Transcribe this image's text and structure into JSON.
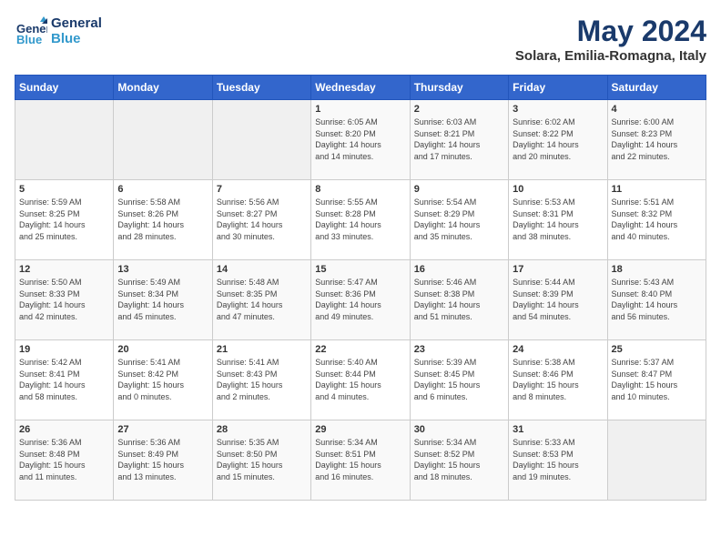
{
  "header": {
    "logo_line1": "General",
    "logo_line2": "Blue",
    "month_year": "May 2024",
    "location": "Solara, Emilia-Romagna, Italy"
  },
  "days_of_week": [
    "Sunday",
    "Monday",
    "Tuesday",
    "Wednesday",
    "Thursday",
    "Friday",
    "Saturday"
  ],
  "weeks": [
    [
      {
        "day": "",
        "content": ""
      },
      {
        "day": "",
        "content": ""
      },
      {
        "day": "",
        "content": ""
      },
      {
        "day": "1",
        "content": "Sunrise: 6:05 AM\nSunset: 8:20 PM\nDaylight: 14 hours\nand 14 minutes."
      },
      {
        "day": "2",
        "content": "Sunrise: 6:03 AM\nSunset: 8:21 PM\nDaylight: 14 hours\nand 17 minutes."
      },
      {
        "day": "3",
        "content": "Sunrise: 6:02 AM\nSunset: 8:22 PM\nDaylight: 14 hours\nand 20 minutes."
      },
      {
        "day": "4",
        "content": "Sunrise: 6:00 AM\nSunset: 8:23 PM\nDaylight: 14 hours\nand 22 minutes."
      }
    ],
    [
      {
        "day": "5",
        "content": "Sunrise: 5:59 AM\nSunset: 8:25 PM\nDaylight: 14 hours\nand 25 minutes."
      },
      {
        "day": "6",
        "content": "Sunrise: 5:58 AM\nSunset: 8:26 PM\nDaylight: 14 hours\nand 28 minutes."
      },
      {
        "day": "7",
        "content": "Sunrise: 5:56 AM\nSunset: 8:27 PM\nDaylight: 14 hours\nand 30 minutes."
      },
      {
        "day": "8",
        "content": "Sunrise: 5:55 AM\nSunset: 8:28 PM\nDaylight: 14 hours\nand 33 minutes."
      },
      {
        "day": "9",
        "content": "Sunrise: 5:54 AM\nSunset: 8:29 PM\nDaylight: 14 hours\nand 35 minutes."
      },
      {
        "day": "10",
        "content": "Sunrise: 5:53 AM\nSunset: 8:31 PM\nDaylight: 14 hours\nand 38 minutes."
      },
      {
        "day": "11",
        "content": "Sunrise: 5:51 AM\nSunset: 8:32 PM\nDaylight: 14 hours\nand 40 minutes."
      }
    ],
    [
      {
        "day": "12",
        "content": "Sunrise: 5:50 AM\nSunset: 8:33 PM\nDaylight: 14 hours\nand 42 minutes."
      },
      {
        "day": "13",
        "content": "Sunrise: 5:49 AM\nSunset: 8:34 PM\nDaylight: 14 hours\nand 45 minutes."
      },
      {
        "day": "14",
        "content": "Sunrise: 5:48 AM\nSunset: 8:35 PM\nDaylight: 14 hours\nand 47 minutes."
      },
      {
        "day": "15",
        "content": "Sunrise: 5:47 AM\nSunset: 8:36 PM\nDaylight: 14 hours\nand 49 minutes."
      },
      {
        "day": "16",
        "content": "Sunrise: 5:46 AM\nSunset: 8:38 PM\nDaylight: 14 hours\nand 51 minutes."
      },
      {
        "day": "17",
        "content": "Sunrise: 5:44 AM\nSunset: 8:39 PM\nDaylight: 14 hours\nand 54 minutes."
      },
      {
        "day": "18",
        "content": "Sunrise: 5:43 AM\nSunset: 8:40 PM\nDaylight: 14 hours\nand 56 minutes."
      }
    ],
    [
      {
        "day": "19",
        "content": "Sunrise: 5:42 AM\nSunset: 8:41 PM\nDaylight: 14 hours\nand 58 minutes."
      },
      {
        "day": "20",
        "content": "Sunrise: 5:41 AM\nSunset: 8:42 PM\nDaylight: 15 hours\nand 0 minutes."
      },
      {
        "day": "21",
        "content": "Sunrise: 5:41 AM\nSunset: 8:43 PM\nDaylight: 15 hours\nand 2 minutes."
      },
      {
        "day": "22",
        "content": "Sunrise: 5:40 AM\nSunset: 8:44 PM\nDaylight: 15 hours\nand 4 minutes."
      },
      {
        "day": "23",
        "content": "Sunrise: 5:39 AM\nSunset: 8:45 PM\nDaylight: 15 hours\nand 6 minutes."
      },
      {
        "day": "24",
        "content": "Sunrise: 5:38 AM\nSunset: 8:46 PM\nDaylight: 15 hours\nand 8 minutes."
      },
      {
        "day": "25",
        "content": "Sunrise: 5:37 AM\nSunset: 8:47 PM\nDaylight: 15 hours\nand 10 minutes."
      }
    ],
    [
      {
        "day": "26",
        "content": "Sunrise: 5:36 AM\nSunset: 8:48 PM\nDaylight: 15 hours\nand 11 minutes."
      },
      {
        "day": "27",
        "content": "Sunrise: 5:36 AM\nSunset: 8:49 PM\nDaylight: 15 hours\nand 13 minutes."
      },
      {
        "day": "28",
        "content": "Sunrise: 5:35 AM\nSunset: 8:50 PM\nDaylight: 15 hours\nand 15 minutes."
      },
      {
        "day": "29",
        "content": "Sunrise: 5:34 AM\nSunset: 8:51 PM\nDaylight: 15 hours\nand 16 minutes."
      },
      {
        "day": "30",
        "content": "Sunrise: 5:34 AM\nSunset: 8:52 PM\nDaylight: 15 hours\nand 18 minutes."
      },
      {
        "day": "31",
        "content": "Sunrise: 5:33 AM\nSunset: 8:53 PM\nDaylight: 15 hours\nand 19 minutes."
      },
      {
        "day": "",
        "content": ""
      }
    ]
  ]
}
